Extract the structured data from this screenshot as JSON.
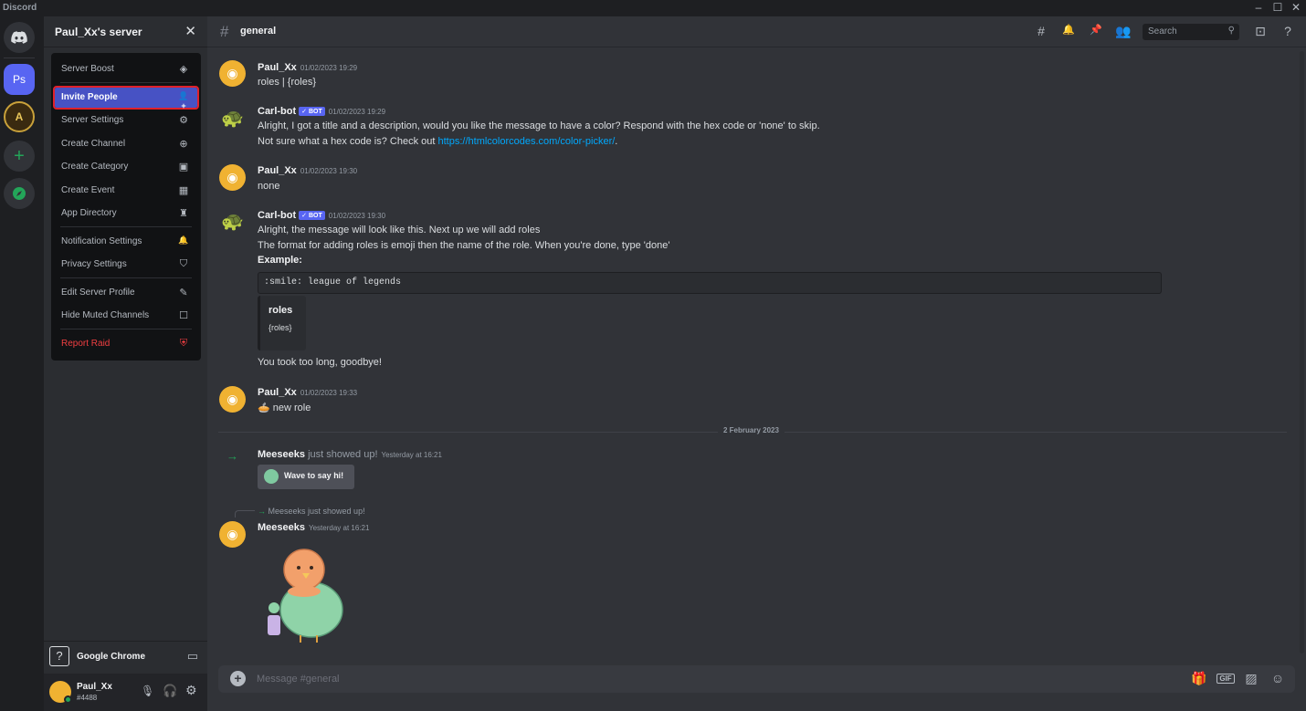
{
  "app_title": "Discord",
  "window_controls": [
    "–",
    "☐",
    "✕"
  ],
  "guild_bar": {
    "home_icon": "discord-logo-icon",
    "servers": [
      {
        "label": "Ps",
        "color": "#5865f2"
      },
      {
        "label": "A",
        "color": "#3a2a10"
      }
    ],
    "add_server_icon": "plus-icon",
    "explore_icon": "compass-icon"
  },
  "sidebar": {
    "server_name": "Paul_Xx's server",
    "close_glyph": "✕",
    "menu": [
      {
        "label": "Server Boost",
        "icon": "boost-gem-icon",
        "glyph": "◈"
      },
      {
        "label": "Invite People",
        "icon": "add-person-icon",
        "glyph": "👤+",
        "active": true
      },
      {
        "label": "Server Settings",
        "icon": "gear-icon",
        "glyph": "⚙"
      },
      {
        "label": "Create Channel",
        "icon": "plus-circle-icon",
        "glyph": "⊕"
      },
      {
        "label": "Create Category",
        "icon": "folder-plus-icon",
        "glyph": "▣"
      },
      {
        "label": "Create Event",
        "icon": "calendar-plus-icon",
        "glyph": "▦"
      },
      {
        "label": "App Directory",
        "icon": "robot-icon",
        "glyph": "♜"
      },
      {
        "label": "Notification Settings",
        "icon": "bell-icon",
        "glyph": "🔔"
      },
      {
        "label": "Privacy Settings",
        "icon": "shield-icon",
        "glyph": "⛉"
      },
      {
        "label": "Edit Server Profile",
        "icon": "pencil-icon",
        "glyph": "✎"
      },
      {
        "label": "Hide Muted Channels",
        "icon": "checkbox-icon",
        "glyph": "☐"
      },
      {
        "label": "Report Raid",
        "icon": "shield-alert-icon",
        "glyph": "⛨",
        "danger": true
      }
    ],
    "activity": {
      "app": "Google Chrome",
      "icon_glyph": "?"
    },
    "user": {
      "name": "Paul_Xx",
      "tag": "#4488"
    }
  },
  "channel": {
    "name": "general",
    "search_placeholder": "Search",
    "composer_placeholder": "Message #general"
  },
  "messages": {
    "m1": {
      "author": "Paul_Xx",
      "time": "01/02/2023 19:29",
      "text": "roles | {roles}"
    },
    "m2": {
      "author": "Carl-bot",
      "badge": "✓ BOT",
      "time": "01/02/2023 19:29",
      "line1": "Alright, I got a title and a description, would you like the message to have a color? Respond with the hex code or 'none' to skip.",
      "line2_prefix": "Not sure what a hex code is? Check out ",
      "line2_link": "https://htmlcolorcodes.com/color-picker/",
      "line2_suffix": "."
    },
    "m3": {
      "author": "Paul_Xx",
      "time": "01/02/2023 19:30",
      "text": "none"
    },
    "m4": {
      "author": "Carl-bot",
      "badge": "✓ BOT",
      "time": "01/02/2023 19:30",
      "line1": "Alright, the message will look like this. Next up we will add roles",
      "line2": "The format for adding roles is emoji then the name of the role. When you're done, type 'done'",
      "line3": "Example:",
      "code": ":smile: league of legends",
      "embed_title": "roles",
      "embed_desc": "{roles}",
      "line4": "You took too long, goodbye!"
    },
    "m5": {
      "author": "Paul_Xx",
      "time": "01/02/2023 19:33",
      "emoji": "🥧",
      "text": "new role"
    },
    "date_divider": "2 February 2023",
    "join": {
      "author": "Meeseeks",
      "text": "just showed up!",
      "time": "Yesterday at 16:21",
      "button": "Wave to say hi!"
    },
    "reply_ref": "Meeseeks just showed up!",
    "m6": {
      "author": "Meeseeks",
      "time": "Yesterday at 16:21"
    }
  },
  "colors": {
    "accent": "#5865f2",
    "active_item": "#4752c4",
    "highlight_outline": "#e0212b",
    "danger": "#f23f42",
    "link": "#00a8fc"
  }
}
